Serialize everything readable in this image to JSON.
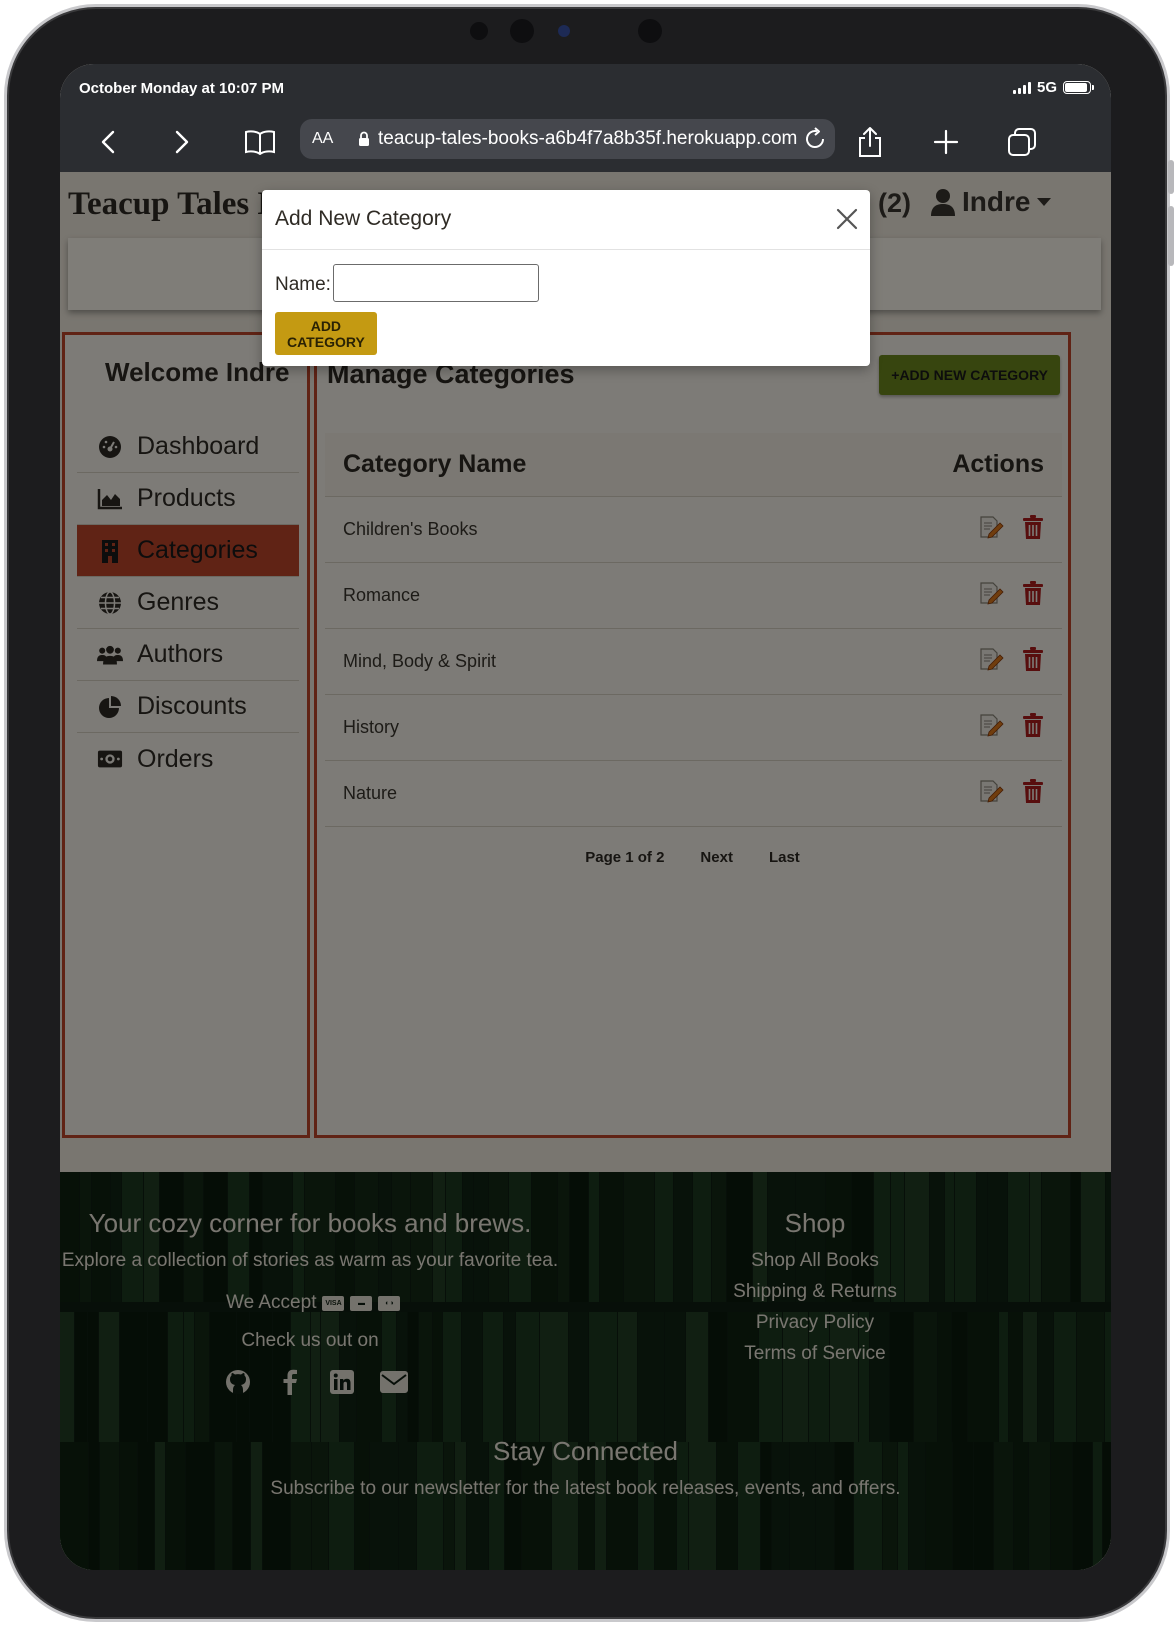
{
  "status_bar": {
    "time": "October Monday at 10:07 PM",
    "network": "5G"
  },
  "browser": {
    "text_size_label": "AA",
    "url": "teacup-tales-books-a6b4f7a8b35f.herokuapp.com"
  },
  "header": {
    "brand": "Teacup Tales B",
    "cart_count": "(2)",
    "user_name": "Indre"
  },
  "sidebar": {
    "welcome": "Welcome Indre",
    "items": [
      {
        "label": "Dashboard",
        "icon": "gauge-icon"
      },
      {
        "label": "Products",
        "icon": "chart-area-icon"
      },
      {
        "label": "Categories",
        "icon": "building-icon",
        "active": true
      },
      {
        "label": "Genres",
        "icon": "globe-icon"
      },
      {
        "label": "Authors",
        "icon": "users-icon"
      },
      {
        "label": "Discounts",
        "icon": "pie-chart-icon"
      },
      {
        "label": "Orders",
        "icon": "money-bill-icon"
      }
    ]
  },
  "main": {
    "title": "Manage Categories",
    "add_new_label": "+ADD NEW CATEGORY",
    "table": {
      "col_name": "Category Name",
      "col_actions": "Actions",
      "rows": [
        "Children's Books",
        "Romance",
        "Mind, Body & Spirit",
        "History",
        "Nature"
      ]
    },
    "pager": {
      "page_info": "Page 1 of 2",
      "next": "Next",
      "last": "Last"
    }
  },
  "footer": {
    "tagline": "Your cozy corner for books and brews.",
    "subtitle": "Explore a collection of stories as warm as your favorite tea.",
    "we_accept": "We Accept",
    "check_us": "Check us out on",
    "shop_title": "Shop",
    "shop_links": [
      "Shop All Books",
      "Shipping & Returns",
      "Privacy Policy",
      "Terms of Service"
    ],
    "stay_title": "Stay Connected",
    "newsletter": "Subscribe to our newsletter for the latest book releases, events, and offers."
  },
  "modal": {
    "title": "Add New Category",
    "name_label": "Name:",
    "name_value": "",
    "submit_label": "ADD CATEGORY"
  },
  "colors": {
    "accent_red": "#c0462a",
    "add_new_green": "#6e8a1f",
    "submit_gold": "#c49a12",
    "delete_red": "#b01c1c"
  }
}
